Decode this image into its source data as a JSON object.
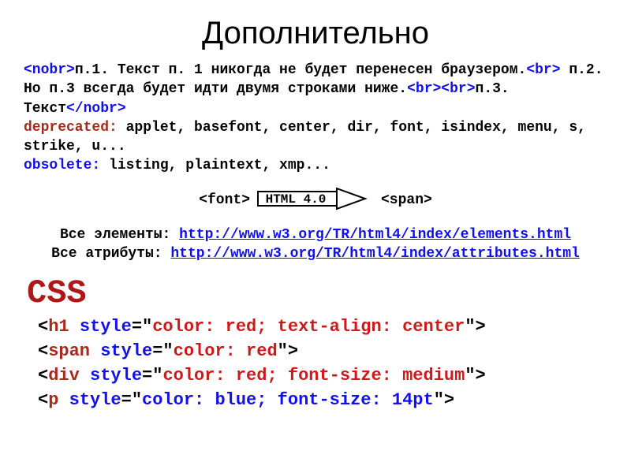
{
  "title": "Дополнительно",
  "nobr_example": {
    "open_tag": "<nobr>",
    "body1": "п.1. Текст п. 1 никогда не будет перенесен браузером.",
    "br1": "<br>",
    "body2": " п.2. Но п.3 всегда будет идти двумя строками ниже.",
    "br2": "<br><br>",
    "body3": "п.3. Текст",
    "close_tag": "</nobr>"
  },
  "deprecated": {
    "label": "deprecated:",
    "list": " applet, basefont, center, dir, font, isindex, menu, s, strike, u..."
  },
  "obsolete": {
    "label": "obsolete:",
    "list": " listing, plaintext, xmp..."
  },
  "diagram": {
    "left": "<font>",
    "box": "HTML 4.0",
    "right": "<span>"
  },
  "links": {
    "elements_label": "Все элементы: ",
    "elements_url": "http://www.w3.org/TR/html4/index/elements.html",
    "attrs_label": "Все атрибуты: ",
    "attrs_url": "http://www.w3.org/TR/html4/index/attributes.html"
  },
  "css": {
    "heading": "CSS",
    "ex1": {
      "open": "<",
      "name": "h1",
      "sp": " ",
      "attr": "style",
      "eq": "=\"",
      "val": "color: red; text-align: center",
      "close": "\">"
    },
    "ex2": {
      "open": "<",
      "name": "span",
      "sp": " ",
      "attr": "style",
      "eq": "=\"",
      "val": "color: red",
      "close": "\">"
    },
    "ex3": {
      "open": "<",
      "name": "div",
      "sp": " ",
      "attr": "style",
      "eq": "=\"",
      "val": "color: red; font-size: medium",
      "close": "\">"
    },
    "ex4": {
      "open": "<",
      "name": "p",
      "sp": " ",
      "attr": "style",
      "eq": "=\"",
      "val": "color: blue; font-size: 14pt",
      "close": "\">"
    }
  }
}
